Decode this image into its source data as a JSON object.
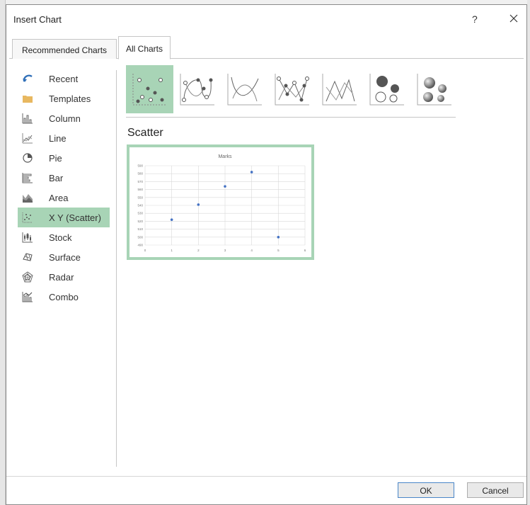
{
  "dialog": {
    "title": "Insert Chart",
    "help": "?",
    "close_icon": "close-icon"
  },
  "tabs": [
    {
      "label": "Recommended Charts",
      "selected": false
    },
    {
      "label": "All Charts",
      "selected": true
    }
  ],
  "sidebar": {
    "items": [
      {
        "label": "Recent",
        "icon": "recent-icon"
      },
      {
        "label": "Templates",
        "icon": "folder-icon"
      },
      {
        "label": "Column",
        "icon": "column-chart-icon"
      },
      {
        "label": "Line",
        "icon": "line-chart-icon"
      },
      {
        "label": "Pie",
        "icon": "pie-chart-icon"
      },
      {
        "label": "Bar",
        "icon": "bar-chart-icon"
      },
      {
        "label": "Area",
        "icon": "area-chart-icon"
      },
      {
        "label": "X Y (Scatter)",
        "icon": "scatter-chart-icon",
        "selected": true
      },
      {
        "label": "Stock",
        "icon": "stock-chart-icon"
      },
      {
        "label": "Surface",
        "icon": "surface-chart-icon"
      },
      {
        "label": "Radar",
        "icon": "radar-chart-icon"
      },
      {
        "label": "Combo",
        "icon": "combo-chart-icon"
      }
    ]
  },
  "gallery": {
    "subtypes": [
      {
        "icon": "scatter-icon",
        "selected": true
      },
      {
        "icon": "scatter-smooth-markers-icon"
      },
      {
        "icon": "scatter-smooth-lines-icon"
      },
      {
        "icon": "scatter-straight-markers-icon"
      },
      {
        "icon": "scatter-straight-lines-icon"
      },
      {
        "icon": "bubble-icon"
      },
      {
        "icon": "3d-bubble-icon"
      }
    ]
  },
  "preview": {
    "section_title": "Scatter"
  },
  "chart_data": {
    "type": "scatter",
    "title": "Marks",
    "x": [
      1,
      2,
      3,
      4,
      5
    ],
    "y": [
      522,
      541,
      564,
      582,
      500
    ],
    "xlim": [
      0,
      6
    ],
    "ylim": [
      490,
      590
    ],
    "x_ticks": [
      "0",
      "1",
      "2",
      "3",
      "4",
      "5",
      "6"
    ],
    "y_ticks": [
      "490",
      "500",
      "510",
      "520",
      "530",
      "540",
      "550",
      "560",
      "570",
      "580",
      "590"
    ],
    "grid": true,
    "point_color": "#4472c4"
  },
  "buttons": {
    "ok": "OK",
    "cancel": "Cancel"
  },
  "colors": {
    "selection": "#a8d4b6",
    "ok_border": "#4a86c8"
  }
}
